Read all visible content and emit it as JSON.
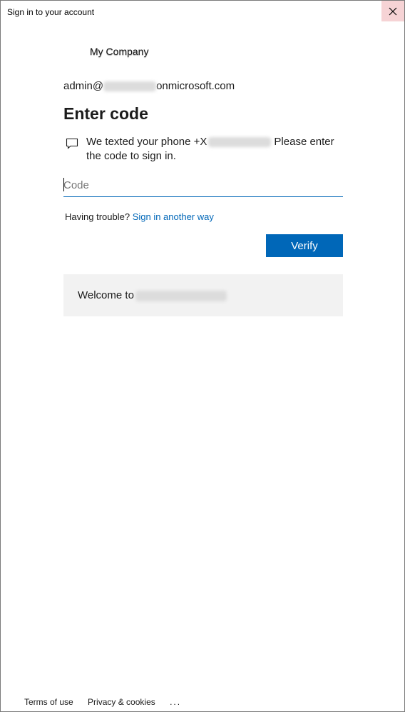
{
  "window": {
    "title": "Sign in to your account",
    "close_icon": "close-icon"
  },
  "company": {
    "name": "My Company"
  },
  "identity": {
    "prefix": "admin@",
    "suffix": "onmicrosoft.com"
  },
  "heading": "Enter code",
  "message": {
    "icon": "message-icon",
    "part1": "We texted your phone +X",
    "part2": "Please enter the code to sign in."
  },
  "code_input": {
    "placeholder": "Code",
    "value": ""
  },
  "trouble": {
    "text": "Having trouble?",
    "link": "Sign in another way"
  },
  "verify_label": "Verify",
  "welcome": {
    "text": "Welcome to"
  },
  "footer": {
    "terms": "Terms of use",
    "privacy": "Privacy & cookies",
    "more": "..."
  },
  "colors": {
    "accent": "#0067b8",
    "close_hover": "#f6d3d5",
    "panel": "#f2f2f2"
  }
}
